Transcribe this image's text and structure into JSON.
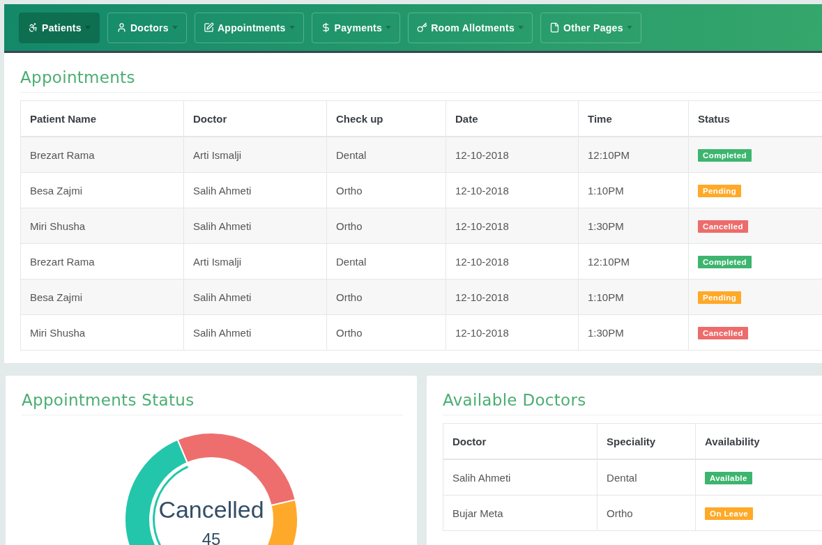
{
  "nav": [
    {
      "label": "Patients",
      "kind": "wheelchair",
      "selected": true
    },
    {
      "label": "Doctors",
      "kind": "user",
      "selected": false
    },
    {
      "label": "Appointments",
      "kind": "edit",
      "selected": false
    },
    {
      "label": "Payments",
      "kind": "dollar",
      "selected": false
    },
    {
      "label": "Room Allotments",
      "kind": "key",
      "selected": false
    },
    {
      "label": "Other Pages",
      "kind": "file",
      "selected": false
    }
  ],
  "appointments": {
    "title": "Appointments",
    "columns": [
      "Patient Name",
      "Doctor",
      "Check up",
      "Date",
      "Time",
      "Status"
    ],
    "rows": [
      {
        "patient": "Brezart Rama",
        "doctor": "Arti Ismalji",
        "checkup": "Dental",
        "date": "12-10-2018",
        "time": "12:10PM",
        "status": {
          "label": "Completed",
          "kind": "success"
        }
      },
      {
        "patient": "Besa Zajmi",
        "doctor": "Salih Ahmeti",
        "checkup": "Ortho",
        "date": "12-10-2018",
        "time": "1:10PM",
        "status": {
          "label": "Pending",
          "kind": "warning"
        }
      },
      {
        "patient": "Miri Shusha",
        "doctor": "Salih Ahmeti",
        "checkup": "Ortho",
        "date": "12-10-2018",
        "time": "1:30PM",
        "status": {
          "label": "Cancelled",
          "kind": "danger"
        }
      },
      {
        "patient": "Brezart Rama",
        "doctor": "Arti Ismalji",
        "checkup": "Dental",
        "date": "12-10-2018",
        "time": "12:10PM",
        "status": {
          "label": "Completed",
          "kind": "success"
        }
      },
      {
        "patient": "Besa Zajmi",
        "doctor": "Salih Ahmeti",
        "checkup": "Ortho",
        "date": "12-10-2018",
        "time": "1:10PM",
        "status": {
          "label": "Pending",
          "kind": "warning"
        }
      },
      {
        "patient": "Miri Shusha",
        "doctor": "Salih Ahmeti",
        "checkup": "Ortho",
        "date": "12-10-2018",
        "time": "1:30PM",
        "status": {
          "label": "Cancelled",
          "kind": "danger"
        }
      }
    ]
  },
  "status_card": {
    "title": "Appointments Status",
    "center_label": "Cancelled",
    "center_value": "45"
  },
  "doctors": {
    "title": "Available Doctors",
    "columns": [
      "Doctor",
      "Speciality",
      "Availability"
    ],
    "rows": [
      {
        "doctor": "Salih Ahmeti",
        "speciality": "Dental",
        "availability": {
          "label": "Available",
          "kind": "success"
        }
      },
      {
        "doctor": "Bujar Meta",
        "speciality": "Ortho",
        "availability": {
          "label": "On Leave",
          "kind": "warning"
        }
      }
    ]
  }
}
